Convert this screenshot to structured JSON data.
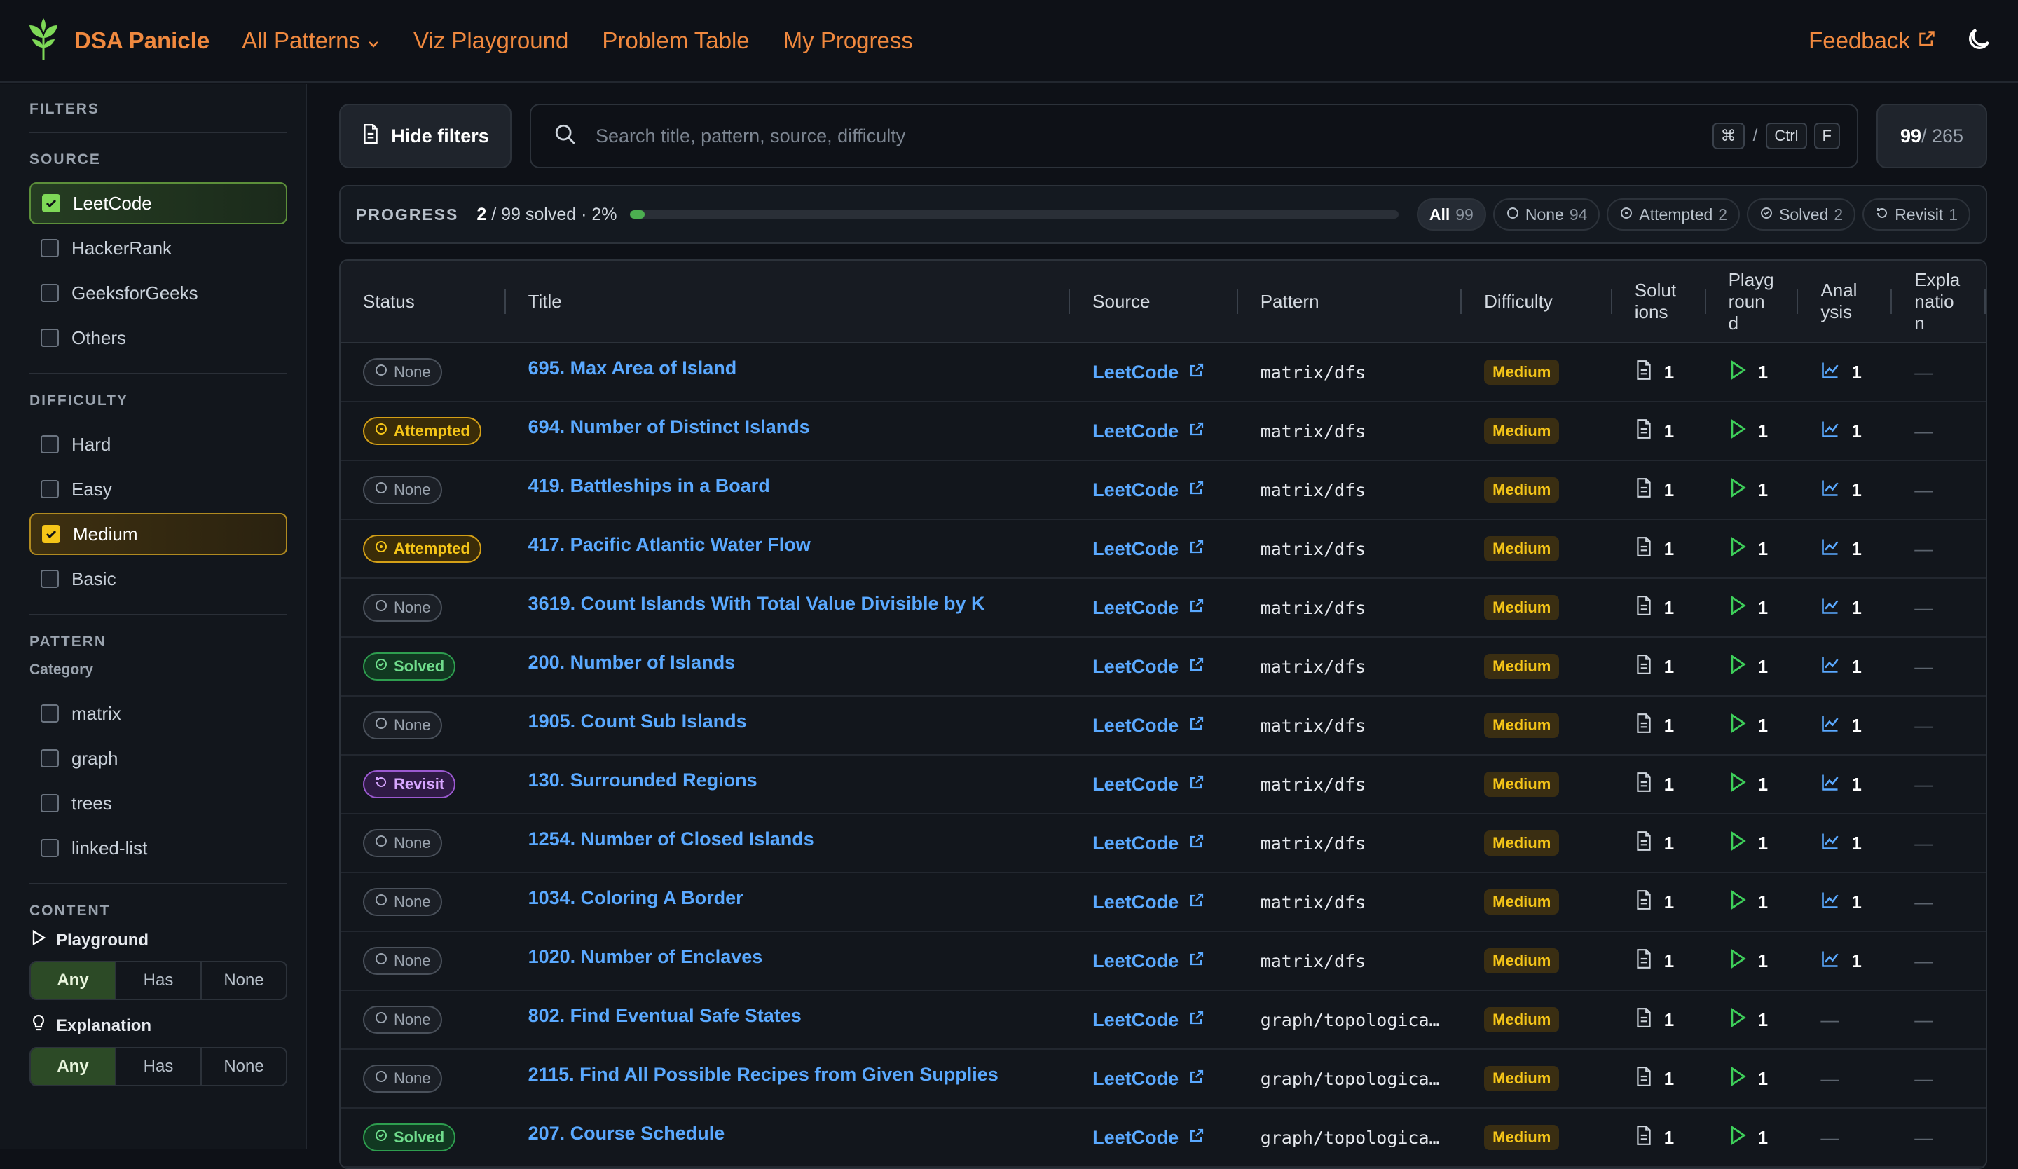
{
  "brand": {
    "name": "DSA Panicle"
  },
  "nav": {
    "all_patterns": "All Patterns",
    "viz": "Viz Playground",
    "table": "Problem Table",
    "progress": "My Progress",
    "feedback": "Feedback"
  },
  "sidebar": {
    "filters": "FILTERS",
    "source_title": "SOURCE",
    "sources": [
      {
        "label": "LeetCode",
        "checked": true
      },
      {
        "label": "HackerRank",
        "checked": false
      },
      {
        "label": "GeeksforGeeks",
        "checked": false
      },
      {
        "label": "Others",
        "checked": false
      }
    ],
    "difficulty_title": "DIFFICULTY",
    "difficulties": [
      {
        "label": "Hard",
        "checked": false
      },
      {
        "label": "Easy",
        "checked": false
      },
      {
        "label": "Medium",
        "checked": true
      },
      {
        "label": "Basic",
        "checked": false
      }
    ],
    "pattern_title": "PATTERN",
    "category_title": "Category",
    "patterns": [
      {
        "label": "matrix"
      },
      {
        "label": "graph"
      },
      {
        "label": "trees"
      },
      {
        "label": "linked-list"
      }
    ],
    "content_title": "CONTENT",
    "playground_label": "Playground",
    "explanation_label": "Explanation",
    "seg": {
      "any": "Any",
      "has": "Has",
      "none": "None"
    }
  },
  "toolbar": {
    "hide_filters": "Hide filters",
    "search_placeholder": "Search title, pattern, source, difficulty",
    "kbd_cmd": "⌘",
    "kbd_sep": "/",
    "kbd_ctrl": "Ctrl",
    "kbd_f": "F",
    "count_shown": "99",
    "count_total": "/ 265"
  },
  "progress": {
    "label": "PROGRESS",
    "solved": "2",
    "text": "/ 99 solved · 2%",
    "fraction": 0.02,
    "chips": [
      {
        "label": "All",
        "n": "99"
      },
      {
        "label": "None",
        "n": "94"
      },
      {
        "label": "Attempted",
        "n": "2"
      },
      {
        "label": "Solved",
        "n": "2"
      },
      {
        "label": "Revisit",
        "n": "1"
      }
    ]
  },
  "table": {
    "headers": {
      "status": "Status",
      "title": "Title",
      "source": "Source",
      "pattern": "Pattern",
      "difficulty": "Difficulty",
      "solutions": "Solut\nions",
      "playground": "Playg\nroun\nd",
      "analysis": "Anal\nysis",
      "explanation": "Expla\nnatio\nn"
    },
    "dash": "—",
    "rows": [
      {
        "status": "None",
        "title": "695. Max Area of Island",
        "source": "LeetCode",
        "pattern": "matrix/dfs",
        "difficulty": "Medium",
        "sol": "1",
        "play": "1",
        "ana": "1"
      },
      {
        "status": "Attempted",
        "title": "694. Number of Distinct Islands",
        "source": "LeetCode",
        "pattern": "matrix/dfs",
        "difficulty": "Medium",
        "sol": "1",
        "play": "1",
        "ana": "1"
      },
      {
        "status": "None",
        "title": "419. Battleships in a Board",
        "source": "LeetCode",
        "pattern": "matrix/dfs",
        "difficulty": "Medium",
        "sol": "1",
        "play": "1",
        "ana": "1"
      },
      {
        "status": "Attempted",
        "title": "417. Pacific Atlantic Water Flow",
        "source": "LeetCode",
        "pattern": "matrix/dfs",
        "difficulty": "Medium",
        "sol": "1",
        "play": "1",
        "ana": "1"
      },
      {
        "status": "None",
        "title": "3619. Count Islands With Total Value Divisible by K",
        "source": "LeetCode",
        "pattern": "matrix/dfs",
        "difficulty": "Medium",
        "sol": "1",
        "play": "1",
        "ana": "1"
      },
      {
        "status": "Solved",
        "title": "200. Number of Islands",
        "source": "LeetCode",
        "pattern": "matrix/dfs",
        "difficulty": "Medium",
        "sol": "1",
        "play": "1",
        "ana": "1"
      },
      {
        "status": "None",
        "title": "1905. Count Sub Islands",
        "source": "LeetCode",
        "pattern": "matrix/dfs",
        "difficulty": "Medium",
        "sol": "1",
        "play": "1",
        "ana": "1"
      },
      {
        "status": "Revisit",
        "title": "130. Surrounded Regions",
        "source": "LeetCode",
        "pattern": "matrix/dfs",
        "difficulty": "Medium",
        "sol": "1",
        "play": "1",
        "ana": "1"
      },
      {
        "status": "None",
        "title": "1254. Number of Closed Islands",
        "source": "LeetCode",
        "pattern": "matrix/dfs",
        "difficulty": "Medium",
        "sol": "1",
        "play": "1",
        "ana": "1"
      },
      {
        "status": "None",
        "title": "1034. Coloring A Border",
        "source": "LeetCode",
        "pattern": "matrix/dfs",
        "difficulty": "Medium",
        "sol": "1",
        "play": "1",
        "ana": "1"
      },
      {
        "status": "None",
        "title": "1020. Number of Enclaves",
        "source": "LeetCode",
        "pattern": "matrix/dfs",
        "difficulty": "Medium",
        "sol": "1",
        "play": "1",
        "ana": "1"
      },
      {
        "status": "None",
        "title": "802. Find Eventual Safe States",
        "source": "LeetCode",
        "pattern": "graph/topologica…",
        "difficulty": "Medium",
        "sol": "1",
        "play": "1",
        "ana": ""
      },
      {
        "status": "None",
        "title": "2115. Find All Possible Recipes from Given Supplies",
        "source": "LeetCode",
        "pattern": "graph/topologica…",
        "difficulty": "Medium",
        "sol": "1",
        "play": "1",
        "ana": ""
      },
      {
        "status": "Solved",
        "title": "207. Course Schedule",
        "source": "LeetCode",
        "pattern": "graph/topologica…",
        "difficulty": "Medium",
        "sol": "1",
        "play": "1",
        "ana": ""
      }
    ]
  },
  "colors": {
    "accent": "#f0893f",
    "link": "#5aa9ff",
    "medium": "#f5c518",
    "solved": "#6fdc8c",
    "revisit": "#d7a6ff",
    "play": "#3ecf5a"
  }
}
